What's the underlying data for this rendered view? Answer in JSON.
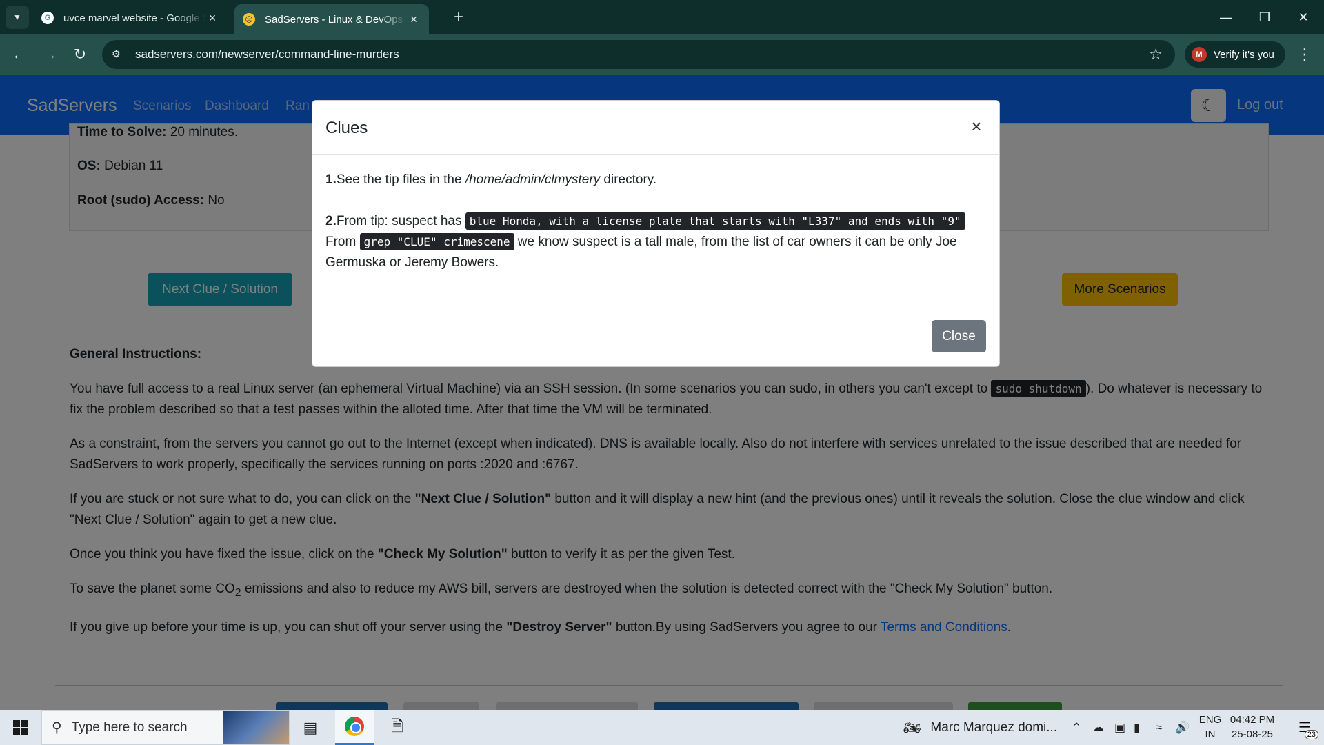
{
  "browser": {
    "tabs": [
      {
        "title": "uvce marvel website - Google S",
        "icon": "google-icon"
      },
      {
        "title": "SadServers - Linux & DevOps Tr",
        "icon": "sadservers-icon"
      }
    ],
    "url": "sadservers.com/newserver/command-line-murders",
    "profile_label": "Verify it's you",
    "profile_initial": "M"
  },
  "site": {
    "brand": "SadServers",
    "nav": [
      "Scenarios",
      "Dashboard",
      "Ran"
    ],
    "logout": "Log out"
  },
  "scenario": {
    "time_label": "Time to Solve:",
    "time_value": "20 minutes.",
    "os_label": "OS:",
    "os_value": "Debian 11",
    "root_label": "Root (sudo) Access:",
    "root_value": "No"
  },
  "buttons": {
    "next_clue": "Next Clue / Solution",
    "more_scenarios": "More Scenarios"
  },
  "instructions": {
    "heading": "General Instructions:",
    "p1_a": "You have full access to a real Linux server (an ephemeral Virtual Machine) via an SSH session. (In some scenarios you can sudo, in others you can't except to ",
    "p1_code": "sudo shutdown",
    "p1_b": "). Do whatever is necessary to fix the problem described so that a test passes within the alloted time. After that time the VM will be terminated.",
    "p2": "As a constraint, from the servers you cannot go out to the Internet (except when indicated). DNS is available locally. Also do not interfere with services unrelated to the issue described that are needed for SadServers to work properly, specifically the services running on ports :2020 and :6767.",
    "p3_a": "If you are stuck or not sure what to do, you can click on the ",
    "p3_bold": "\"Next Clue / Solution\"",
    "p3_b": " button and it will display a new hint (and the previous ones) until it reveals the solution. Close the clue window and click \"Next Clue / Solution\" again to get a new clue.",
    "p4_a": "Once you think you have fixed the issue, click on the ",
    "p4_bold": "\"Check My Solution\"",
    "p4_b": " button to verify it as per the given Test.",
    "p5_a": "To save the planet some CO",
    "p5_sub": "2",
    "p5_b": " emissions and also to reduce my AWS bill, servers are destroyed when the solution is detected correct with the \"Check My Solution\" button.",
    "p6_a": "If you give up before your time is up, you can shut off your server using the ",
    "p6_bold": "\"Destroy Server\"",
    "p6_b": " button.By using SadServers you agree to our ",
    "p6_link": "Terms and Conditions",
    "p6_c": "."
  },
  "modal": {
    "title": "Clues",
    "clue1_num": "1.",
    "clue1_a": "See the tip files in the ",
    "clue1_path": "/home/admin/clmystery",
    "clue1_b": " directory.",
    "clue2_num": "2.",
    "clue2_a": "From tip: suspect has ",
    "clue2_code1": "blue Honda, with a license plate that starts with \"L337\" and ends with \"9\"",
    "clue2_b": "From ",
    "clue2_code2": "grep \"CLUE\" crimescene",
    "clue2_c": " we know suspect is a tall male, from the list of car owners it can be only Joe Germuska or Jeremy Bowers.",
    "close_label": "Close"
  },
  "taskbar": {
    "search_placeholder": "Type here to search",
    "news": "Marc Marquez domi...",
    "lang_top": "ENG",
    "lang_bottom": "IN",
    "time": "04:42 PM",
    "date": "25-08-25",
    "notification_count": "23"
  },
  "colors": {
    "chrome_dark": "#0e2e2b",
    "chrome_toolbar": "#26504b",
    "site_nav": "#0d6efd",
    "btn_info": "#17a2b8",
    "btn_warning": "#ffc107",
    "btn_secondary": "#6c757d"
  }
}
